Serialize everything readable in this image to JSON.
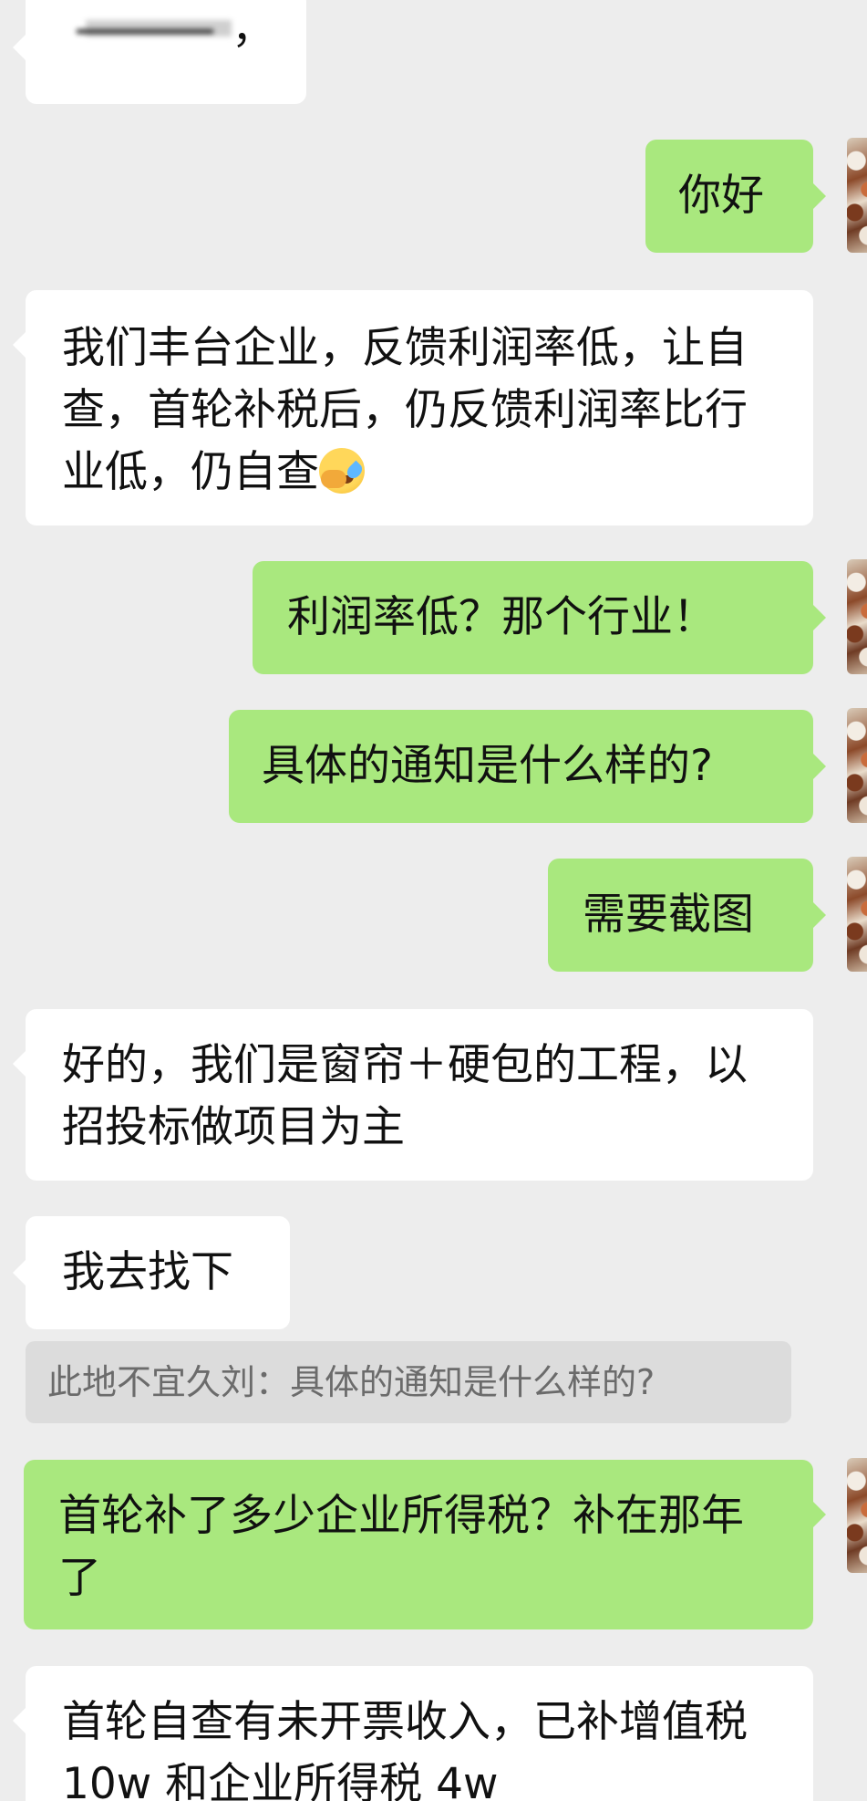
{
  "messages": [
    {
      "id": "m0",
      "side": "in",
      "text": "，",
      "note_blurred": true
    },
    {
      "id": "m1",
      "side": "out",
      "text": "你好"
    },
    {
      "id": "m2",
      "side": "in",
      "text": "我们丰台企业，反馈利润率低，让自查，首轮补税后，仍反馈利润率比行业低，仍自查",
      "emoji": "crying-face-emoji"
    },
    {
      "id": "m3",
      "side": "out",
      "text": "利润率低？那个行业！"
    },
    {
      "id": "m4",
      "side": "out",
      "text": "具体的通知是什么样的?"
    },
    {
      "id": "m5",
      "side": "out",
      "text": "需要截图"
    },
    {
      "id": "m6",
      "side": "in",
      "text": "好的，我们是窗帘＋硬包的工程，以招投标做项目为主"
    },
    {
      "id": "m7",
      "side": "in",
      "text": "我去找下"
    },
    {
      "id": "m8",
      "side": "quote",
      "text": "此地不宜久刘：具体的通知是什么样的?"
    },
    {
      "id": "m9",
      "side": "out",
      "text": "首轮补了多少企业所得税？补在那年了"
    },
    {
      "id": "m10",
      "side": "in",
      "text": "首轮自查有未开票收入，已补增值税 10w 和企业所得税 4w"
    }
  ],
  "colors": {
    "background": "#ededed",
    "incoming_bubble": "#ffffff",
    "outgoing_bubble": "#a9e87e",
    "quote_bg": "#dcdcdc",
    "quote_text": "#6b6b6b"
  }
}
